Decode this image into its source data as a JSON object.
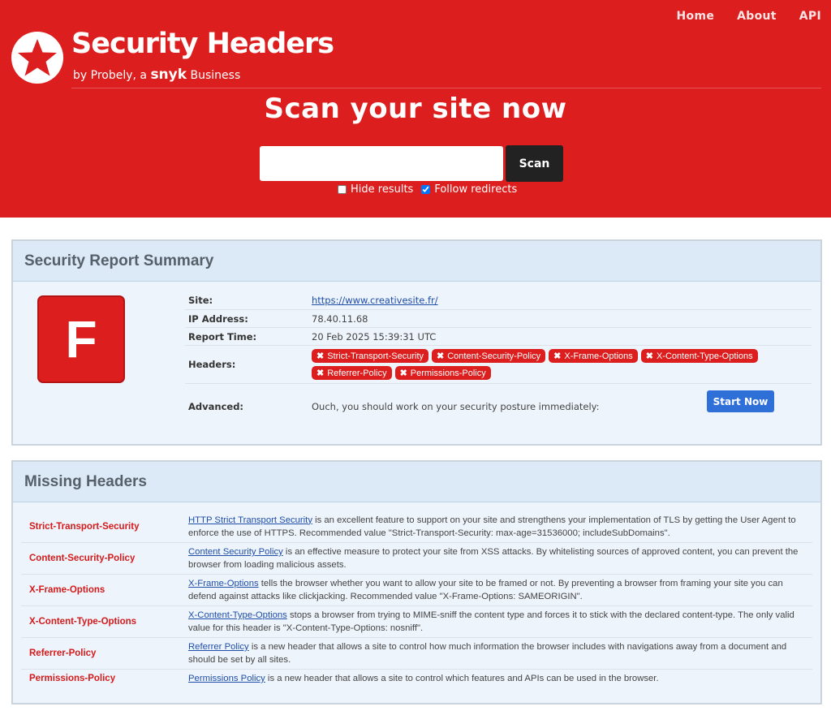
{
  "nav": {
    "home": "Home",
    "about": "About",
    "api": "API"
  },
  "brand": {
    "title": "Security Headers",
    "sub_prefix": "by Probely, a ",
    "sub_snyk": "snyk",
    "sub_suffix": " Business"
  },
  "scan": {
    "title": "Scan your site now",
    "input_value": "",
    "button": "Scan",
    "hide_results_label": "Hide results",
    "hide_results_checked": false,
    "follow_redirects_label": "Follow redirects",
    "follow_redirects_checked": true
  },
  "summary": {
    "heading": "Security Report Summary",
    "grade": "F",
    "site_label": "Site:",
    "site_value": "https://www.creativesite.fr/",
    "ip_label": "IP Address:",
    "ip_value": "78.40.11.68",
    "time_label": "Report Time:",
    "time_value": "20 Feb 2025 15:39:31 UTC",
    "headers_label": "Headers:",
    "headers": [
      "Strict-Transport-Security",
      "Content-Security-Policy",
      "X-Frame-Options",
      "X-Content-Type-Options",
      "Referrer-Policy",
      "Permissions-Policy"
    ],
    "advanced_label": "Advanced:",
    "advanced_value": "Ouch, you should work on your security posture immediately:",
    "start_button": "Start Now"
  },
  "missing": {
    "heading": "Missing Headers",
    "rows": [
      {
        "name": "Strict-Transport-Security",
        "link": "HTTP Strict Transport Security",
        "text": " is an excellent feature to support on your site and strengthens your implementation of TLS by getting the User Agent to enforce the use of HTTPS. Recommended value \"Strict-Transport-Security: max-age=31536000; includeSubDomains\"."
      },
      {
        "name": "Content-Security-Policy",
        "link": "Content Security Policy",
        "text": " is an effective measure to protect your site from XSS attacks. By whitelisting sources of approved content, you can prevent the browser from loading malicious assets."
      },
      {
        "name": "X-Frame-Options",
        "link": "X-Frame-Options",
        "text": " tells the browser whether you want to allow your site to be framed or not. By preventing a browser from framing your site you can defend against attacks like clickjacking. Recommended value \"X-Frame-Options: SAMEORIGIN\"."
      },
      {
        "name": "X-Content-Type-Options",
        "link": "X-Content-Type-Options",
        "text": " stops a browser from trying to MIME-sniff the content type and forces it to stick with the declared content-type. The only valid value for this header is \"X-Content-Type-Options: nosniff\"."
      },
      {
        "name": "Referrer-Policy",
        "link": "Referrer Policy",
        "text": " is a new header that allows a site to control how much information the browser includes with navigations away from a document and should be set by all sites."
      },
      {
        "name": "Permissions-Policy",
        "link": "Permissions Policy",
        "text": " is a new header that allows a site to control which features and APIs can be used in the browser."
      }
    ]
  },
  "colors": {
    "brand_red": "#dc1e1e",
    "panel_bg": "#eef4fb",
    "panel_head": "#dce9f6",
    "button_blue": "#2f6fd8",
    "dark_button": "#222222"
  }
}
